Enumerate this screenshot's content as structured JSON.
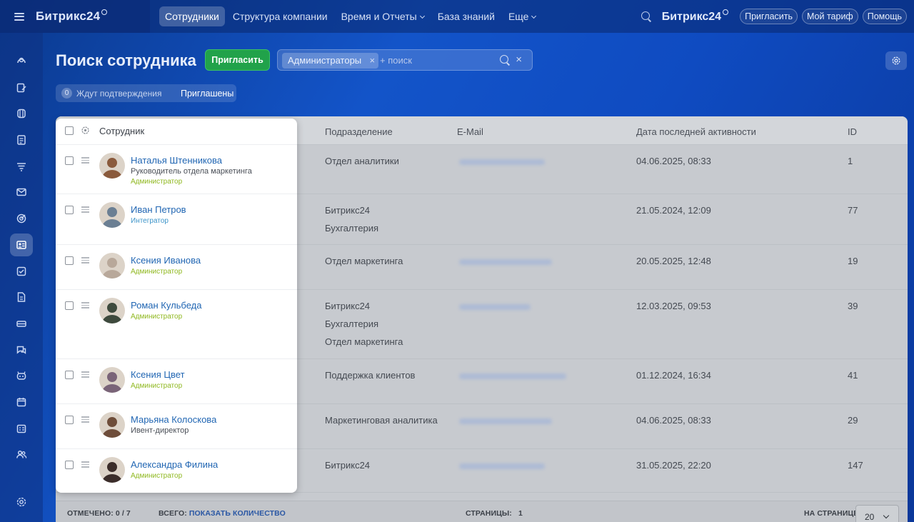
{
  "topbar": {
    "brand": "Битрикс24",
    "nav": [
      {
        "label": "Сотрудники",
        "active": true,
        "caret": false
      },
      {
        "label": "Структура компании",
        "active": false,
        "caret": false
      },
      {
        "label": "Время и Отчеты",
        "active": false,
        "caret": true
      },
      {
        "label": "База знаний",
        "active": false,
        "caret": false
      },
      {
        "label": "Еще",
        "active": false,
        "caret": true
      }
    ],
    "brand_right": "Битрикс24",
    "invite_label": "Пригласить",
    "tariff_label": "Мой тариф",
    "help_label": "Помощь"
  },
  "rail": {
    "icons": [
      "feed-icon",
      "tasks-edit-icon",
      "crm-icon",
      "docs-icon",
      "funnel-icon",
      "mail-icon",
      "target-icon",
      "employees-icon",
      "checkbox-icon",
      "document-icon",
      "inventory-icon",
      "chat-icon",
      "bot-icon",
      "calendar-icon",
      "planner-icon",
      "users-icon"
    ],
    "active_index": 7
  },
  "page": {
    "title": "Поиск сотрудника",
    "invite_button": "Пригласить",
    "filter_chip": "Администраторы",
    "search_placeholder": "+ поиск",
    "pending_count": "0",
    "pending_label": "Ждут подтверждения",
    "invited_label": "Приглашены"
  },
  "grid": {
    "columns": {
      "employee": "Сотрудник",
      "department": "Подразделение",
      "email": "E-Mail",
      "last_activity": "Дата последней активности",
      "id": "ID"
    },
    "rows": [
      {
        "name": "Наталья Штенникова",
        "position": "Руководитель отдела маркетинга",
        "role": "Администратор",
        "role_type": "admin",
        "departments": [
          "Отдел аналитики"
        ],
        "activity": "04.06.2025, 08:33",
        "id": "1",
        "avatar_color": "#8a5a3c"
      },
      {
        "name": "Иван Петров",
        "position": "",
        "role": "Интегратор",
        "role_type": "integrator",
        "departments": [
          "Битрикс24",
          "Бухгалтерия"
        ],
        "activity": "21.05.2024, 12:09",
        "id": "77",
        "avatar_color": "#6b7f93"
      },
      {
        "name": "Ксения Иванова",
        "position": "",
        "role": "Администратор",
        "role_type": "admin",
        "departments": [
          "Отдел маркетинга"
        ],
        "activity": "20.05.2025, 12:48",
        "id": "19",
        "avatar_color": "#b8a89a"
      },
      {
        "name": "Роман Кульбеда",
        "position": "",
        "role": "Администратор",
        "role_type": "admin",
        "departments": [
          "Битрикс24",
          "Бухгалтерия",
          "Отдел маркетинга"
        ],
        "activity": "12.03.2025, 09:53",
        "id": "39",
        "avatar_color": "#3e4a3d"
      },
      {
        "name": "Ксения Цвет",
        "position": "",
        "role": "Администратор",
        "role_type": "admin",
        "departments": [
          "Поддержка клиентов"
        ],
        "activity": "01.12.2024, 16:34",
        "id": "41",
        "avatar_color": "#7a6478"
      },
      {
        "name": "Марьяна Колоскова",
        "position": "Ивент-директор",
        "role": "",
        "role_type": "none",
        "departments": [
          "Маркетинговая аналитика"
        ],
        "activity": "04.06.2025, 08:33",
        "id": "29",
        "avatar_color": "#6e4d3a"
      },
      {
        "name": "Александра Филина",
        "position": "",
        "role": "Администратор",
        "role_type": "admin",
        "departments": [
          "Битрикс24"
        ],
        "activity": "31.05.2025, 22:20",
        "id": "147",
        "avatar_color": "#3b2d2a"
      }
    ]
  },
  "footer": {
    "marked_label": "ОТМЕЧЕНО:",
    "marked_value": "0 / 7",
    "total_label": "ВСЕГО:",
    "total_link": "ПОКАЗАТЬ КОЛИЧЕСТВО",
    "pages_label": "СТРАНИЦЫ:",
    "pages_value": "1",
    "per_page_label": "НА СТРАНИЦЕ:",
    "per_page_value": "20"
  }
}
